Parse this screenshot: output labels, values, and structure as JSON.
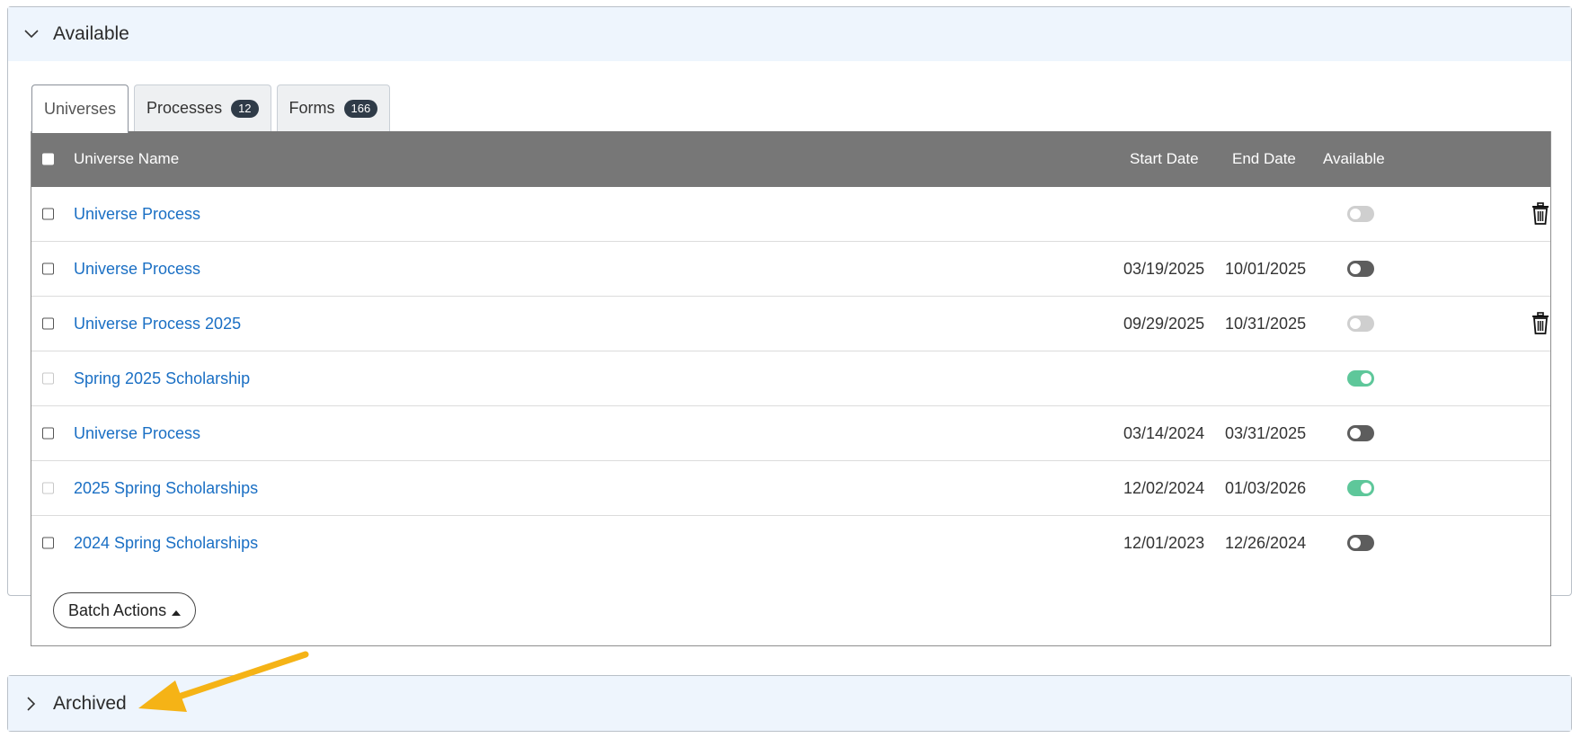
{
  "available_section": {
    "title": "Available"
  },
  "tabs": [
    {
      "label": "Universes",
      "count": null
    },
    {
      "label": "Processes",
      "count": "12"
    },
    {
      "label": "Forms",
      "count": "166"
    }
  ],
  "table": {
    "columns": {
      "name": "Universe Name",
      "start": "Start Date",
      "end": "End Date",
      "available": "Available"
    },
    "rows": [
      {
        "name": "Universe Process",
        "start": "",
        "end": "",
        "toggle": "off-light",
        "trash": true,
        "checkbox": "normal"
      },
      {
        "name": "Universe Process",
        "start": "03/19/2025",
        "end": "10/01/2025",
        "toggle": "off-dark",
        "trash": false,
        "checkbox": "normal"
      },
      {
        "name": "Universe Process 2025",
        "start": "09/29/2025",
        "end": "10/31/2025",
        "toggle": "off-light",
        "trash": true,
        "checkbox": "normal"
      },
      {
        "name": "Spring 2025 Scholarship",
        "start": "",
        "end": "",
        "toggle": "on",
        "trash": false,
        "checkbox": "dim"
      },
      {
        "name": "Universe Process",
        "start": "03/14/2024",
        "end": "03/31/2025",
        "toggle": "off-dark",
        "trash": false,
        "checkbox": "normal"
      },
      {
        "name": "2025 Spring Scholarships",
        "start": "12/02/2024",
        "end": "01/03/2026",
        "toggle": "on",
        "trash": false,
        "checkbox": "dim"
      },
      {
        "name": "2024 Spring Scholarships",
        "start": "12/01/2023",
        "end": "12/26/2024",
        "toggle": "off-dark",
        "trash": false,
        "checkbox": "normal"
      }
    ]
  },
  "batch_actions": {
    "label": "Batch Actions"
  },
  "archived_section": {
    "title": "Archived"
  },
  "colors": {
    "link": "#1a6fc4",
    "header_bg": "#777777",
    "panel_head_bg": "#eef5fd",
    "toggle_on": "#5ec79a",
    "annotation_arrow": "#f5b316"
  },
  "icons": {
    "expanded": "chevron-down-icon",
    "collapsed": "chevron-right-icon",
    "delete": "trash-icon",
    "caret": "caret-up-icon"
  }
}
